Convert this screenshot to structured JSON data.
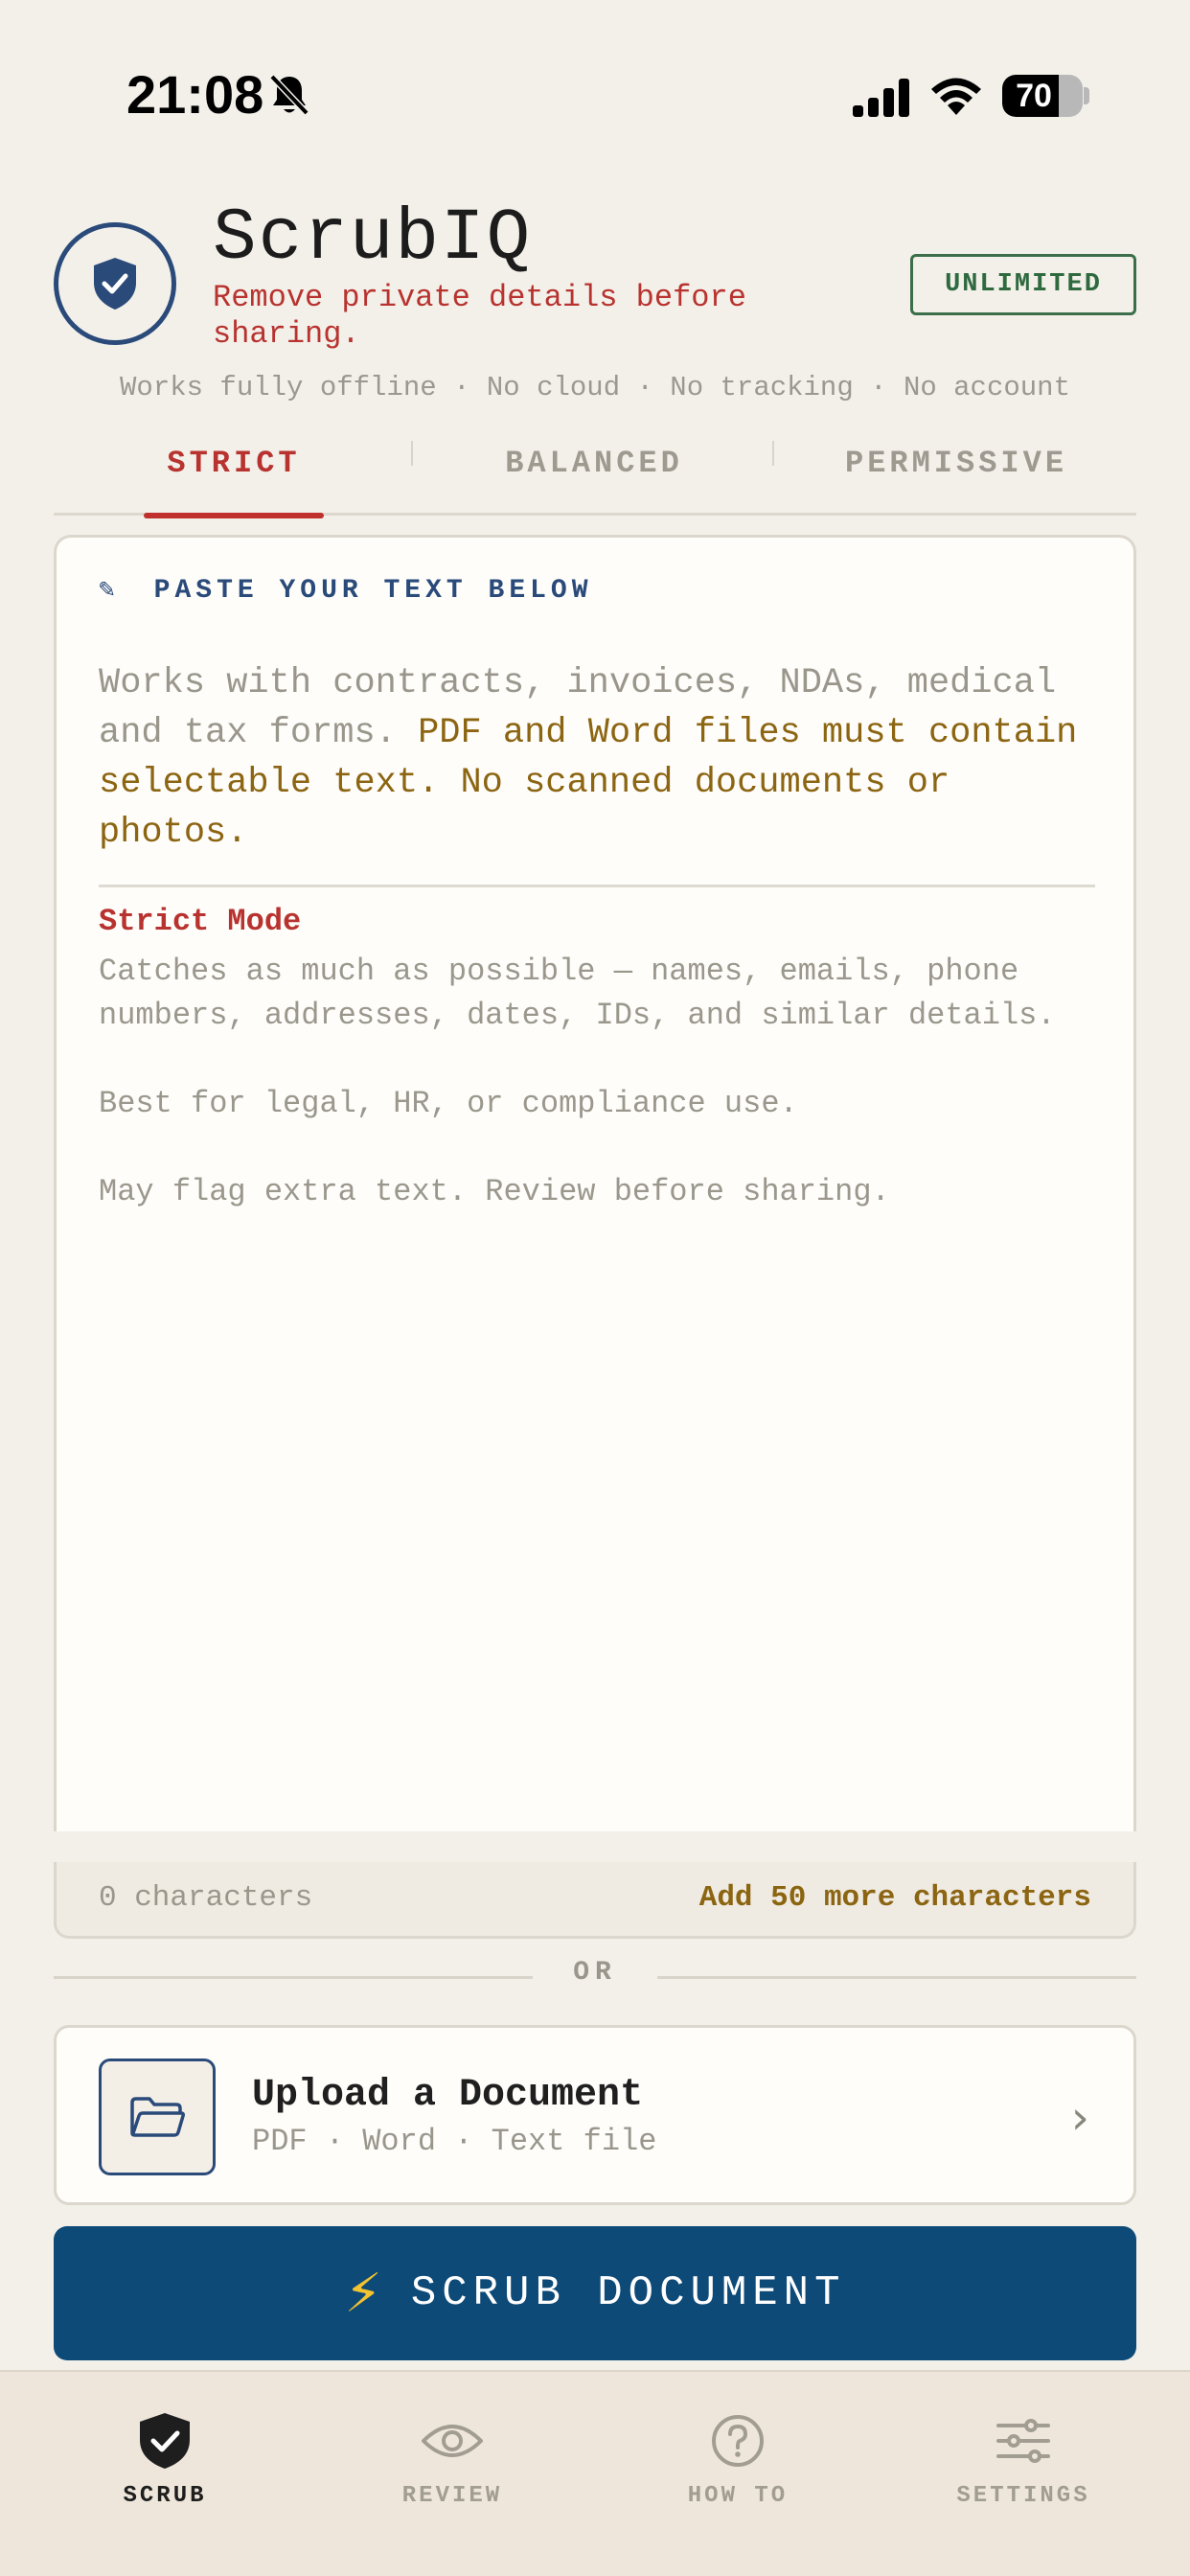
{
  "status_bar": {
    "time": "21:08",
    "battery_percent": "70",
    "battery_level": 0.7,
    "icons": [
      "bell-muted-icon",
      "cellular-signal-icon",
      "wifi-icon",
      "battery-icon"
    ]
  },
  "header": {
    "title": "ScrubIQ",
    "tagline": "Remove private details before sharing.",
    "plan_badge": "UNLIMITED",
    "offline_note": "Works fully offline · No cloud · No tracking · No account"
  },
  "tabs": [
    {
      "label": "STRICT",
      "active": true
    },
    {
      "label": "BALANCED",
      "active": false
    },
    {
      "label": "PERMISSIVE",
      "active": false
    }
  ],
  "input_card": {
    "heading_icon": "✎",
    "heading": "PASTE YOUR TEXT BELOW",
    "hint_plain": "Works with contracts, invoices, NDAs, medical and tax forms. ",
    "hint_warning": "PDF and Word files must contain selectable text. No scanned documents or photos.",
    "mode_title": "Strict Mode",
    "mode_description": "Catches as much as possible — names, emails, phone numbers, addresses, dates, IDs, and similar details.\n\nBest for legal, HR, or compliance use.\n\nMay flag extra text. Review before sharing.",
    "char_count": "0 characters",
    "char_requirement": "Add 50 more characters"
  },
  "divider_text": "OR",
  "upload": {
    "title": "Upload a Document",
    "subtitle": "PDF · Word · Text file",
    "chevron": "›"
  },
  "primary_action": {
    "icon": "⚡",
    "label": "SCRUB DOCUMENT"
  },
  "bottom_nav": [
    {
      "label": "SCRUB",
      "icon": "shield-check-icon",
      "active": true
    },
    {
      "label": "REVIEW",
      "icon": "eye-icon",
      "active": false
    },
    {
      "label": "HOW TO",
      "icon": "help-circle-icon",
      "active": false
    },
    {
      "label": "SETTINGS",
      "icon": "sliders-icon",
      "active": false
    }
  ],
  "colors": {
    "background": "#f3f0ea",
    "accent_red": "#b8332f",
    "brand_blue": "#2a4a7a",
    "button_blue": "#0d4a78",
    "warning_gold": "#8c6512",
    "badge_green": "#2f6a3f"
  }
}
